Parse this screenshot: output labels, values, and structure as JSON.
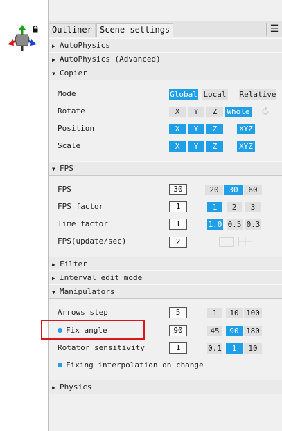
{
  "tabs": [
    {
      "label": "Outliner",
      "active": true
    },
    {
      "label": "Scene settings",
      "active": false
    }
  ],
  "menu_icon": "hamburger-icon",
  "sections": {
    "autophysics": {
      "label": "AutoPhysics",
      "expanded": false
    },
    "autophysics_adv": {
      "label": "AutoPhysics (Advanced)",
      "expanded": false
    },
    "copier": {
      "label": "Copier",
      "expanded": true
    },
    "fps": {
      "label": "FPS",
      "expanded": true
    },
    "filter": {
      "label": "Filter",
      "expanded": false
    },
    "interval": {
      "label": "Interval edit mode",
      "expanded": false
    },
    "manipulators": {
      "label": "Manipulators",
      "expanded": true
    },
    "physics": {
      "label": "Physics",
      "expanded": false
    }
  },
  "copier": {
    "mode": {
      "label": "Mode",
      "options": [
        "Global",
        "Local",
        "Relative"
      ],
      "selected": "Global"
    },
    "rotate": {
      "label": "Rotate",
      "options": [
        "X",
        "Y",
        "Z",
        "Whole"
      ],
      "selected": "Whole"
    },
    "position": {
      "label": "Position",
      "options": [
        "X",
        "Y",
        "Z",
        "XYZ"
      ],
      "selected": [
        "X",
        "Y",
        "Z",
        "XYZ"
      ]
    },
    "scale": {
      "label": "Scale",
      "options": [
        "X",
        "Y",
        "Z",
        "XYZ"
      ],
      "selected": [
        "X",
        "Y",
        "Z",
        "XYZ"
      ]
    }
  },
  "fps": {
    "fps": {
      "label": "FPS",
      "value": "30",
      "presets": [
        "20",
        "30",
        "60"
      ],
      "selected": "30"
    },
    "fps_factor": {
      "label": "FPS factor",
      "value": "1",
      "presets": [
        "1",
        "2",
        "3"
      ],
      "selected": "1"
    },
    "time_factor": {
      "label": "Time factor",
      "value": "1",
      "presets": [
        "1.0",
        "0.5",
        "0.3"
      ],
      "selected": "1.0"
    },
    "fps_update": {
      "label": "FPS(update/sec)",
      "value": "2"
    }
  },
  "manipulators": {
    "arrows_step": {
      "label": "Arrows step",
      "value": "5",
      "presets": [
        "1",
        "10",
        "100"
      ],
      "selected": ""
    },
    "fix_angle": {
      "label": "Fix angle",
      "value": "90",
      "presets": [
        "45",
        "90",
        "180"
      ],
      "selected": "90"
    },
    "rotator_sensitivity": {
      "label": "Rotator sensitivity",
      "value": "1",
      "presets": [
        "0.1",
        "1",
        "10"
      ],
      "selected": "1"
    },
    "fixing_interp": {
      "label": "Fixing interpolation on change"
    }
  },
  "colors": {
    "accent": "#1e9fe8",
    "highlight": "#d9161b"
  }
}
